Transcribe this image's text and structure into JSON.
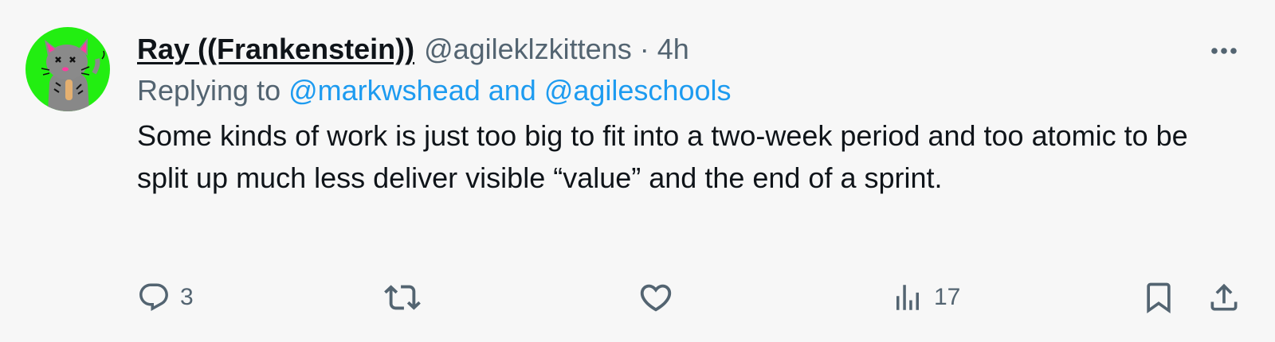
{
  "tweet": {
    "display_name": "Ray ((Frankenstein))",
    "handle": "@agileklzkittens",
    "separator": "·",
    "timestamp": "4h",
    "replying_prefix": "Replying to ",
    "mention_1": "@markwshead",
    "mention_join": " and ",
    "mention_2": "@agileschools",
    "text": "Some kinds of work is just too big to fit into a two-week period and too atomic to be split up much less deliver visible “value” and the end of a sprint."
  },
  "actions": {
    "reply_count": "3",
    "views_count": "17"
  },
  "icons": {
    "avatar": "cat-drawing-avatar",
    "more": "more-options-icon",
    "reply": "reply-icon",
    "retweet": "retweet-icon",
    "like": "heart-icon",
    "views": "views-chart-icon",
    "bookmark": "bookmark-icon",
    "share": "share-icon"
  },
  "colors": {
    "background": "#f7f7f7",
    "text": "#0f1419",
    "secondary": "#536471",
    "link": "#1d9bf0",
    "avatar_bg": "#22ee11"
  }
}
